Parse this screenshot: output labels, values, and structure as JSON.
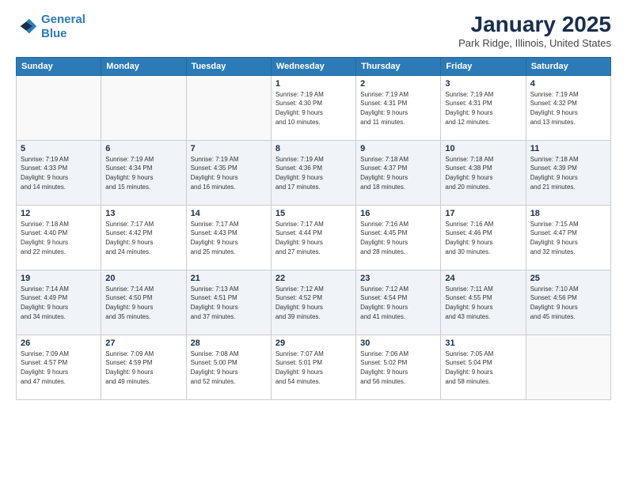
{
  "header": {
    "logo_line1": "General",
    "logo_line2": "Blue",
    "month_title": "January 2025",
    "location": "Park Ridge, Illinois, United States"
  },
  "weekdays": [
    "Sunday",
    "Monday",
    "Tuesday",
    "Wednesday",
    "Thursday",
    "Friday",
    "Saturday"
  ],
  "weeks": [
    [
      {
        "date": "",
        "info": ""
      },
      {
        "date": "",
        "info": ""
      },
      {
        "date": "",
        "info": ""
      },
      {
        "date": "1",
        "info": "Sunrise: 7:19 AM\nSunset: 4:30 PM\nDaylight: 9 hours\nand 10 minutes."
      },
      {
        "date": "2",
        "info": "Sunrise: 7:19 AM\nSunset: 4:31 PM\nDaylight: 9 hours\nand 11 minutes."
      },
      {
        "date": "3",
        "info": "Sunrise: 7:19 AM\nSunset: 4:31 PM\nDaylight: 9 hours\nand 12 minutes."
      },
      {
        "date": "4",
        "info": "Sunrise: 7:19 AM\nSunset: 4:32 PM\nDaylight: 9 hours\nand 13 minutes."
      }
    ],
    [
      {
        "date": "5",
        "info": "Sunrise: 7:19 AM\nSunset: 4:33 PM\nDaylight: 9 hours\nand 14 minutes."
      },
      {
        "date": "6",
        "info": "Sunrise: 7:19 AM\nSunset: 4:34 PM\nDaylight: 9 hours\nand 15 minutes."
      },
      {
        "date": "7",
        "info": "Sunrise: 7:19 AM\nSunset: 4:35 PM\nDaylight: 9 hours\nand 16 minutes."
      },
      {
        "date": "8",
        "info": "Sunrise: 7:19 AM\nSunset: 4:36 PM\nDaylight: 9 hours\nand 17 minutes."
      },
      {
        "date": "9",
        "info": "Sunrise: 7:18 AM\nSunset: 4:37 PM\nDaylight: 9 hours\nand 18 minutes."
      },
      {
        "date": "10",
        "info": "Sunrise: 7:18 AM\nSunset: 4:38 PM\nDaylight: 9 hours\nand 20 minutes."
      },
      {
        "date": "11",
        "info": "Sunrise: 7:18 AM\nSunset: 4:39 PM\nDaylight: 9 hours\nand 21 minutes."
      }
    ],
    [
      {
        "date": "12",
        "info": "Sunrise: 7:18 AM\nSunset: 4:40 PM\nDaylight: 9 hours\nand 22 minutes."
      },
      {
        "date": "13",
        "info": "Sunrise: 7:17 AM\nSunset: 4:42 PM\nDaylight: 9 hours\nand 24 minutes."
      },
      {
        "date": "14",
        "info": "Sunrise: 7:17 AM\nSunset: 4:43 PM\nDaylight: 9 hours\nand 25 minutes."
      },
      {
        "date": "15",
        "info": "Sunrise: 7:17 AM\nSunset: 4:44 PM\nDaylight: 9 hours\nand 27 minutes."
      },
      {
        "date": "16",
        "info": "Sunrise: 7:16 AM\nSunset: 4:45 PM\nDaylight: 9 hours\nand 28 minutes."
      },
      {
        "date": "17",
        "info": "Sunrise: 7:16 AM\nSunset: 4:46 PM\nDaylight: 9 hours\nand 30 minutes."
      },
      {
        "date": "18",
        "info": "Sunrise: 7:15 AM\nSunset: 4:47 PM\nDaylight: 9 hours\nand 32 minutes."
      }
    ],
    [
      {
        "date": "19",
        "info": "Sunrise: 7:14 AM\nSunset: 4:49 PM\nDaylight: 9 hours\nand 34 minutes."
      },
      {
        "date": "20",
        "info": "Sunrise: 7:14 AM\nSunset: 4:50 PM\nDaylight: 9 hours\nand 35 minutes."
      },
      {
        "date": "21",
        "info": "Sunrise: 7:13 AM\nSunset: 4:51 PM\nDaylight: 9 hours\nand 37 minutes."
      },
      {
        "date": "22",
        "info": "Sunrise: 7:12 AM\nSunset: 4:52 PM\nDaylight: 9 hours\nand 39 minutes."
      },
      {
        "date": "23",
        "info": "Sunrise: 7:12 AM\nSunset: 4:54 PM\nDaylight: 9 hours\nand 41 minutes."
      },
      {
        "date": "24",
        "info": "Sunrise: 7:11 AM\nSunset: 4:55 PM\nDaylight: 9 hours\nand 43 minutes."
      },
      {
        "date": "25",
        "info": "Sunrise: 7:10 AM\nSunset: 4:56 PM\nDaylight: 9 hours\nand 45 minutes."
      }
    ],
    [
      {
        "date": "26",
        "info": "Sunrise: 7:09 AM\nSunset: 4:57 PM\nDaylight: 9 hours\nand 47 minutes."
      },
      {
        "date": "27",
        "info": "Sunrise: 7:09 AM\nSunset: 4:59 PM\nDaylight: 9 hours\nand 49 minutes."
      },
      {
        "date": "28",
        "info": "Sunrise: 7:08 AM\nSunset: 5:00 PM\nDaylight: 9 hours\nand 52 minutes."
      },
      {
        "date": "29",
        "info": "Sunrise: 7:07 AM\nSunset: 5:01 PM\nDaylight: 9 hours\nand 54 minutes."
      },
      {
        "date": "30",
        "info": "Sunrise: 7:06 AM\nSunset: 5:02 PM\nDaylight: 9 hours\nand 56 minutes."
      },
      {
        "date": "31",
        "info": "Sunrise: 7:05 AM\nSunset: 5:04 PM\nDaylight: 9 hours\nand 58 minutes."
      },
      {
        "date": "",
        "info": ""
      }
    ]
  ]
}
